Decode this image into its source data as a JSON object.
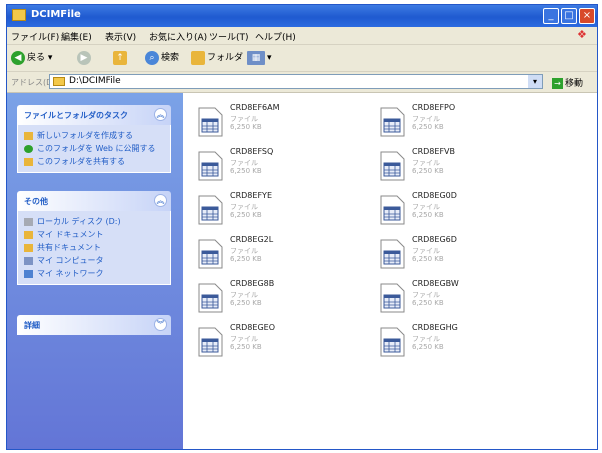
{
  "window": {
    "title": "DCIMFile"
  },
  "menubar": [
    "ファイル(F)",
    "編集(E)",
    "表示(V)",
    "お気に入り(A)",
    "ツール(T)",
    "ヘルプ(H)"
  ],
  "toolbar": {
    "back": "戻る",
    "search": "検索",
    "folders": "フォルダ"
  },
  "address": {
    "label": "アドレス(D)",
    "path": "D:\\DCIMFile",
    "go": "移動"
  },
  "tasks_panel": {
    "title": "ファイルとフォルダのタスク",
    "items": [
      "新しいフォルダを作成する",
      "このフォルダを Web に公開する",
      "このフォルダを共有する"
    ]
  },
  "places_panel": {
    "title": "その他",
    "items": [
      "ローカル ディスク (D:)",
      "マイ ドキュメント",
      "共有ドキュメント",
      "マイ コンピュータ",
      "マイ ネットワーク"
    ]
  },
  "details_panel": {
    "title": "詳細"
  },
  "files": [
    {
      "name": "CRD8EF6AM",
      "type": "ファイル",
      "size": "6,250 KB"
    },
    {
      "name": "CRD8EFPO",
      "type": "ファイル",
      "size": "6,250 KB"
    },
    {
      "name": "CRD8EFSQ",
      "type": "ファイル",
      "size": "6,250 KB"
    },
    {
      "name": "CRD8EFVB",
      "type": "ファイル",
      "size": "6,250 KB"
    },
    {
      "name": "CRD8EFYE",
      "type": "ファイル",
      "size": "6,250 KB"
    },
    {
      "name": "CRD8EG0D",
      "type": "ファイル",
      "size": "6,250 KB"
    },
    {
      "name": "CRD8EG2L",
      "type": "ファイル",
      "size": "6,250 KB"
    },
    {
      "name": "CRD8EG6D",
      "type": "ファイル",
      "size": "6,250 KB"
    },
    {
      "name": "CRD8EG8B",
      "type": "ファイル",
      "size": "6,250 KB"
    },
    {
      "name": "CRD8EGBW",
      "type": "ファイル",
      "size": "6,250 KB"
    },
    {
      "name": "CRD8EGEO",
      "type": "ファイル",
      "size": "6,250 KB"
    },
    {
      "name": "CRD8EGHG",
      "type": "ファイル",
      "size": "6,250 KB"
    }
  ]
}
